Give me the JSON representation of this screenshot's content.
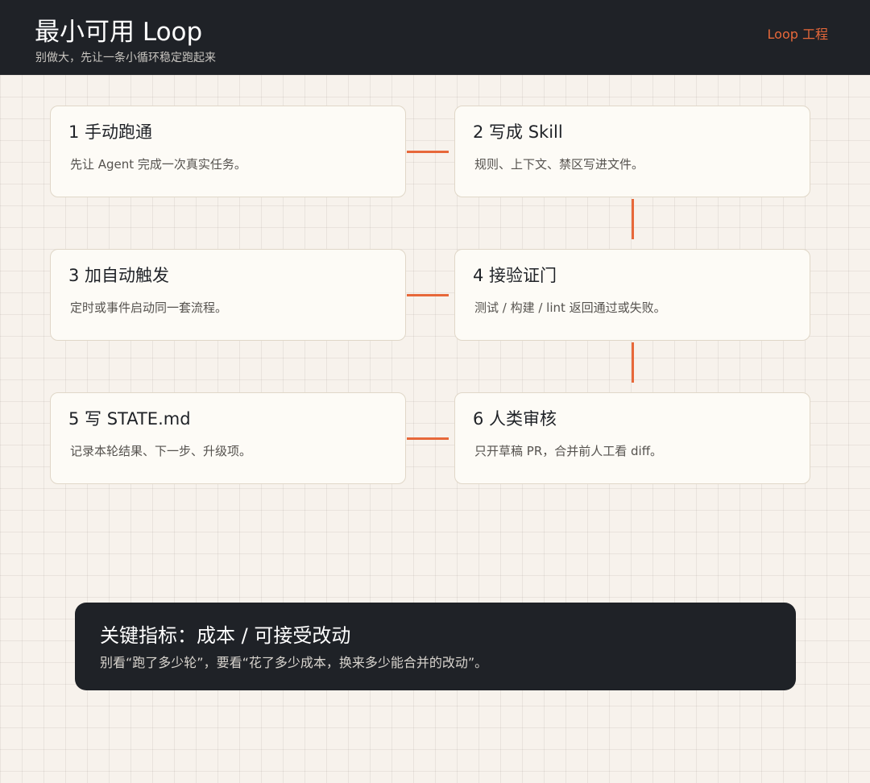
{
  "header": {
    "title": "最小可用 Loop",
    "subtitle": "别做大，先让一条小循环稳定跑起来",
    "tag": "Loop 工程"
  },
  "steps": [
    {
      "title": "1 手动跑通",
      "desc": "先让 Agent 完成一次真实任务。"
    },
    {
      "title": "2 写成 Skill",
      "desc": "规则、上下文、禁区写进文件。"
    },
    {
      "title": "3 加自动触发",
      "desc": "定时或事件启动同一套流程。"
    },
    {
      "title": "4 接验证门",
      "desc": "测试 / 构建 / lint 返回通过或失败。"
    },
    {
      "title": "5 写 STATE.md",
      "desc": "记录本轮结果、下一步、升级项。"
    },
    {
      "title": "6 人类审核",
      "desc": "只开草稿 PR，合并前人工看 diff。"
    }
  ],
  "metric": {
    "title": "关键指标：成本 / 可接受改动",
    "desc": "别看“跑了多少轮”，要看“花了多少成本，换来多少能合并的改动”。"
  },
  "colors": {
    "accent": "#e7683a",
    "dark": "#1f2227",
    "card_bg": "#fdfbf6",
    "page_bg": "#f7f2ec"
  }
}
